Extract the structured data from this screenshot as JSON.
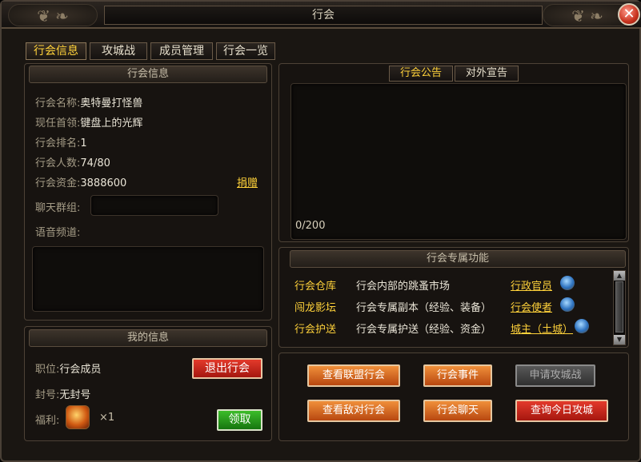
{
  "window": {
    "title": "行会",
    "close_glyph": "✕"
  },
  "tabs": [
    "行会信息",
    "攻城战",
    "成员管理",
    "行会一览"
  ],
  "guild_info": {
    "header": "行会信息",
    "name_label": "行会名称:",
    "name_value": "奥特曼打怪兽",
    "leader_label": "现任首领:",
    "leader_value": "键盘上的光辉",
    "rank_label": "行会排名:",
    "rank_value": "1",
    "members_label": "行会人数:",
    "members_value": "74/80",
    "funds_label": "行会资金:",
    "funds_value": "3888600",
    "donate_link": "捐赠",
    "chat_group_label": "聊天群组:",
    "chat_group_value": "",
    "voice_label": "语音频道:"
  },
  "my_info": {
    "header": "我的信息",
    "position_label": "职位:",
    "position_value": "行会成员",
    "title_label": "封号:",
    "title_value": "无封号",
    "welfare_label": "福利:",
    "welfare_count": "×1",
    "quit_button": "退出行会",
    "claim_button": "领取"
  },
  "notice": {
    "tabs": [
      "行会公告",
      "对外宣告"
    ],
    "counter": "0/200"
  },
  "features": {
    "header": "行会专属功能",
    "rows": [
      {
        "name": "行会仓库",
        "desc": "行会内部的跳蚤市场",
        "role": "行政官员"
      },
      {
        "name": "闯龙影坛",
        "desc": "行会专属副本（经验、装备）",
        "role": "行会使者"
      },
      {
        "name": "行会护送",
        "desc": "行会专属护送（经验、资金）",
        "role": "城主（土城）"
      }
    ]
  },
  "actions": {
    "view_alliance": "查看联盟行会",
    "guild_events": "行会事件",
    "apply_siege": "申请攻城战",
    "view_enemy": "查看敌对行会",
    "guild_chat": "行会聊天",
    "today_siege": "查询今日攻城"
  }
}
